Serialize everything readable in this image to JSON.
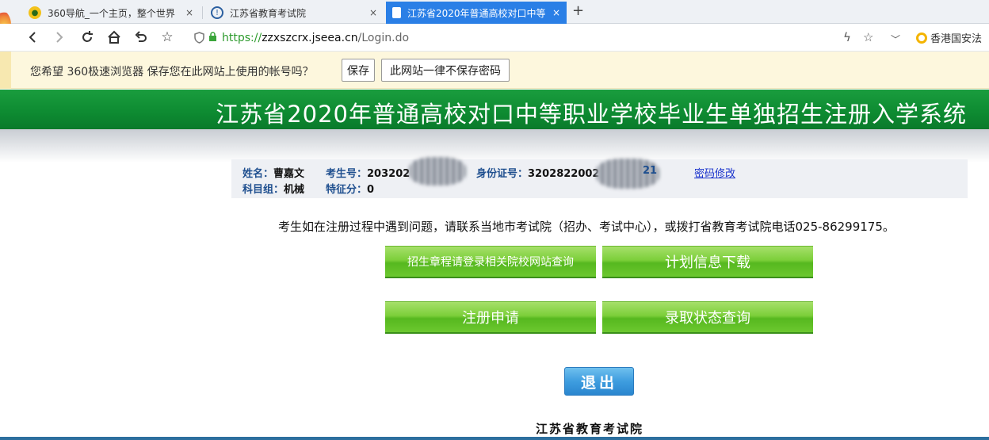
{
  "browser": {
    "tabs": [
      {
        "label": "360导航_一个主页，整个世界",
        "active": false
      },
      {
        "label": "江苏省教育考试院",
        "active": false
      },
      {
        "label": "江苏省2020年普通高校对口中等",
        "active": true
      }
    ],
    "new_tab_glyph": "+",
    "close_glyph": "×",
    "url": {
      "scheme": "https://",
      "host": "zzxszcrx.jseea.cn",
      "path": "/Login.do"
    },
    "search_hint": "香港国安法",
    "icons": [
      "back-icon",
      "forward-icon",
      "reload-icon",
      "home-icon",
      "undo-icon",
      "star-icon",
      "shield-icon",
      "lock-icon",
      "lightning-icon",
      "bookmark-star-icon",
      "chevron-down-icon"
    ]
  },
  "password_bar": {
    "message": "您希望 360极速浏览器 保存您在此网站上使用的帐号吗？",
    "save_label": "保存",
    "never_label": "此网站一律不保存密码"
  },
  "page": {
    "title": "江苏省2020年普通高校对口中等职业学校毕业生单独招生注册入学系统",
    "info": {
      "name_label": "姓名：",
      "name": "曹嘉文",
      "exam_no_label": "考生号：",
      "exam_no": "203202",
      "id_label": "身份证号：",
      "id_no": "3202822002",
      "id_tail": "21",
      "subject_label": "科目组：",
      "subject": "机械",
      "feature_label": "特征分：",
      "feature": "0",
      "change_password": "密码修改"
    },
    "notice": "考生如在注册过程中遇到问题，请联系当地市考试院（招办、考试中心），或拨打省教育考试院电话025-86299175。",
    "buttons": {
      "charter": "招生章程请登录相关院校网站查询",
      "plan_download": "计划信息下载",
      "register": "注册申请",
      "admission_query": "录取状态查询",
      "logout": "退出"
    },
    "footer": "江苏省教育考试院"
  },
  "colors": {
    "banner_green": "#0d8a31",
    "tab_active": "#2a7fe6",
    "button_green": "#6cc82f",
    "logout_blue": "#3e9ddf",
    "link_blue": "#1a33cc"
  }
}
